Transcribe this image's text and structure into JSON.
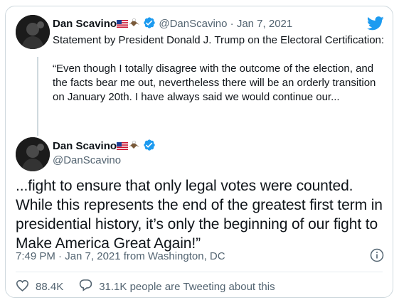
{
  "parent_tweet": {
    "display_name": "Dan Scavino",
    "handle": "@DanScavino",
    "separator": "·",
    "date": "Jan 7, 2021",
    "text_line1": "Statement by President Donald J. Trump on the Electoral Certification:",
    "text_quote": "“Even though I totally disagree with the outcome of the election, and the facts bear me out, nevertheless there will be an orderly transition on January 20th. I have always said we would continue our..."
  },
  "reply_tweet": {
    "display_name": "Dan Scavino",
    "handle": "@DanScavino",
    "text": "...fight to ensure that only legal votes were counted. While this represents the end of the greatest first term in presidential history, it’s only the beginning of our fight to Make America Great Again!”",
    "timestamp": "7:49 PM · Jan 7, 2021 from Washington, DC"
  },
  "actions": {
    "likes": "88.4K",
    "retweet_text": "31.1K people are Tweeting about this"
  },
  "icons": {
    "brand": "twitter-bird-icon",
    "verified": "verified-badge-icon",
    "flag": "us-flag-icon",
    "eagle": "eagle-icon",
    "info": "info-icon",
    "like": "heart-icon",
    "reply": "speech-bubble-icon"
  },
  "colors": {
    "twitter_blue": "#1d9bf0",
    "text": "#0f1419",
    "muted": "#536471",
    "border": "#cfd9de"
  }
}
